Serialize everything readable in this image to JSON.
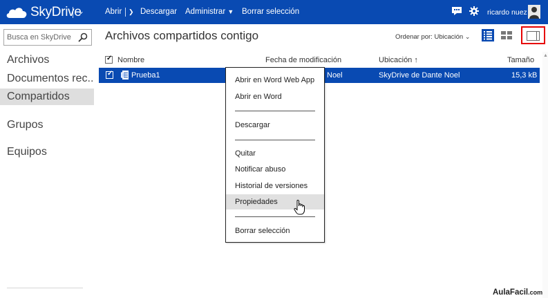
{
  "topbar": {
    "brand": "SkyDrive",
    "commands": {
      "open": "Abrir",
      "download": "Descargar",
      "manage": "Administrar",
      "clear": "Borrar selección"
    },
    "user_name": "ricardo nuez",
    "color": "#094ab2"
  },
  "sidebar": {
    "search_placeholder": "Busca en SkyDrive",
    "items": [
      {
        "label": "Archivos",
        "selected": false
      },
      {
        "label": "Documentos rec...",
        "selected": false
      },
      {
        "label": "Compartidos",
        "selected": true
      },
      {
        "label": "Grupos",
        "selected": false
      },
      {
        "label": "Equipos",
        "selected": false
      }
    ]
  },
  "main": {
    "title": "Archivos compartidos contigo",
    "sort_label": "Ordenar por: Ubicación",
    "columns": {
      "name": "Nombre",
      "modified": "Fecha de modificación",
      "location": "Ubicación",
      "size": "Tamaño"
    },
    "sort_arrow": "↑",
    "rows": [
      {
        "name": "Prueba1",
        "modified_partial": "Noel",
        "location": "SkyDrive de Dante Noel",
        "size": "15,3 kB",
        "selected": true
      }
    ]
  },
  "context_menu": {
    "items": [
      "Abrir en Word Web App",
      "Abrir en Word",
      "Descargar",
      "Quitar",
      "Notificar abuso",
      "Historial de versiones",
      "Propiedades",
      "Borrar selección"
    ],
    "hover_item": "Propiedades"
  },
  "watermark": {
    "main": "AulaFacil",
    "suffix": ".com"
  }
}
